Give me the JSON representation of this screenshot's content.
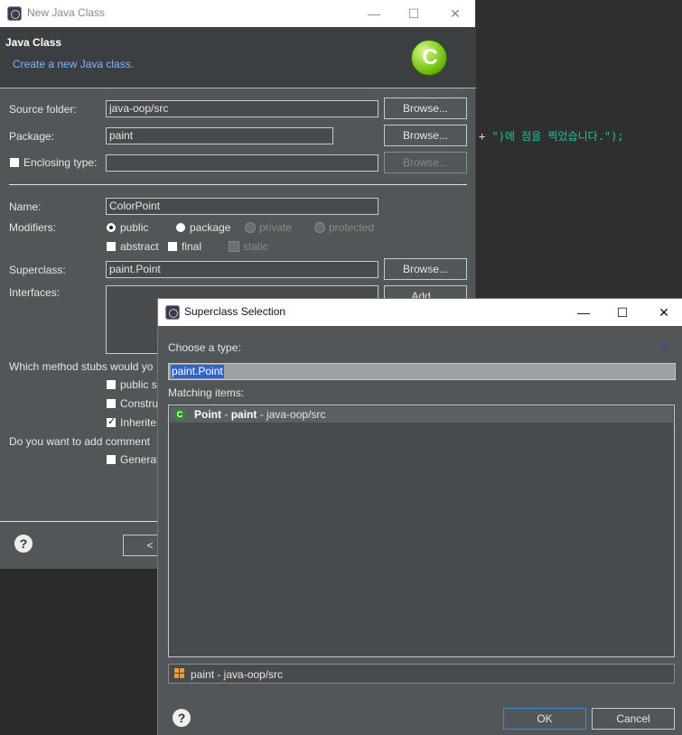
{
  "editor": {
    "code_plus": "+",
    "code_string": "\")에 점을 찍었습니다.\");"
  },
  "new_java_class": {
    "window_title": "New Java Class",
    "header_title": "Java Class",
    "header_subtitle": "Create a new Java class.",
    "source_folder_label": "Source folder:",
    "source_folder_value": "java-oop/src",
    "package_label": "Package:",
    "package_value": "paint",
    "enclosing_type_label": "Enclosing type:",
    "enclosing_type_value": "",
    "browse_label": "Browse...",
    "name_label": "Name:",
    "name_value": "ColorPoint",
    "modifiers_label": "Modifiers:",
    "modifiers": [
      "public",
      "package",
      "private",
      "protected"
    ],
    "modifier_flags": [
      "abstract",
      "final",
      "static"
    ],
    "superclass_label": "Superclass:",
    "superclass_value": "paint.Point",
    "interfaces_label": "Interfaces:",
    "add_label": "Add...",
    "method_stubs_question": "Which method stubs would yo",
    "stub_options": [
      "public s",
      "Constru",
      "Inherite"
    ],
    "comments_question": "Do you want to add comment",
    "generate_label": "Generat",
    "back_label": "<"
  },
  "superclass_selection": {
    "window_title": "Superclass Selection",
    "choose_type_label": "Choose a type:",
    "search_value": "paint.Point",
    "matching_items_label": "Matching items:",
    "items": [
      {
        "type_name": "Point",
        "separator": "-",
        "package": "paint",
        "location": "- java-oop/src"
      }
    ],
    "status_text": "paint - java-oop/src",
    "ok_label": "OK",
    "cancel_label": "Cancel"
  },
  "colors": {
    "dialog_bg": "#515658",
    "header_bg": "#3c3f41",
    "subtitle": "#7fb6ff",
    "selection": "#2f65ca",
    "code_string": "#17c6a3"
  }
}
